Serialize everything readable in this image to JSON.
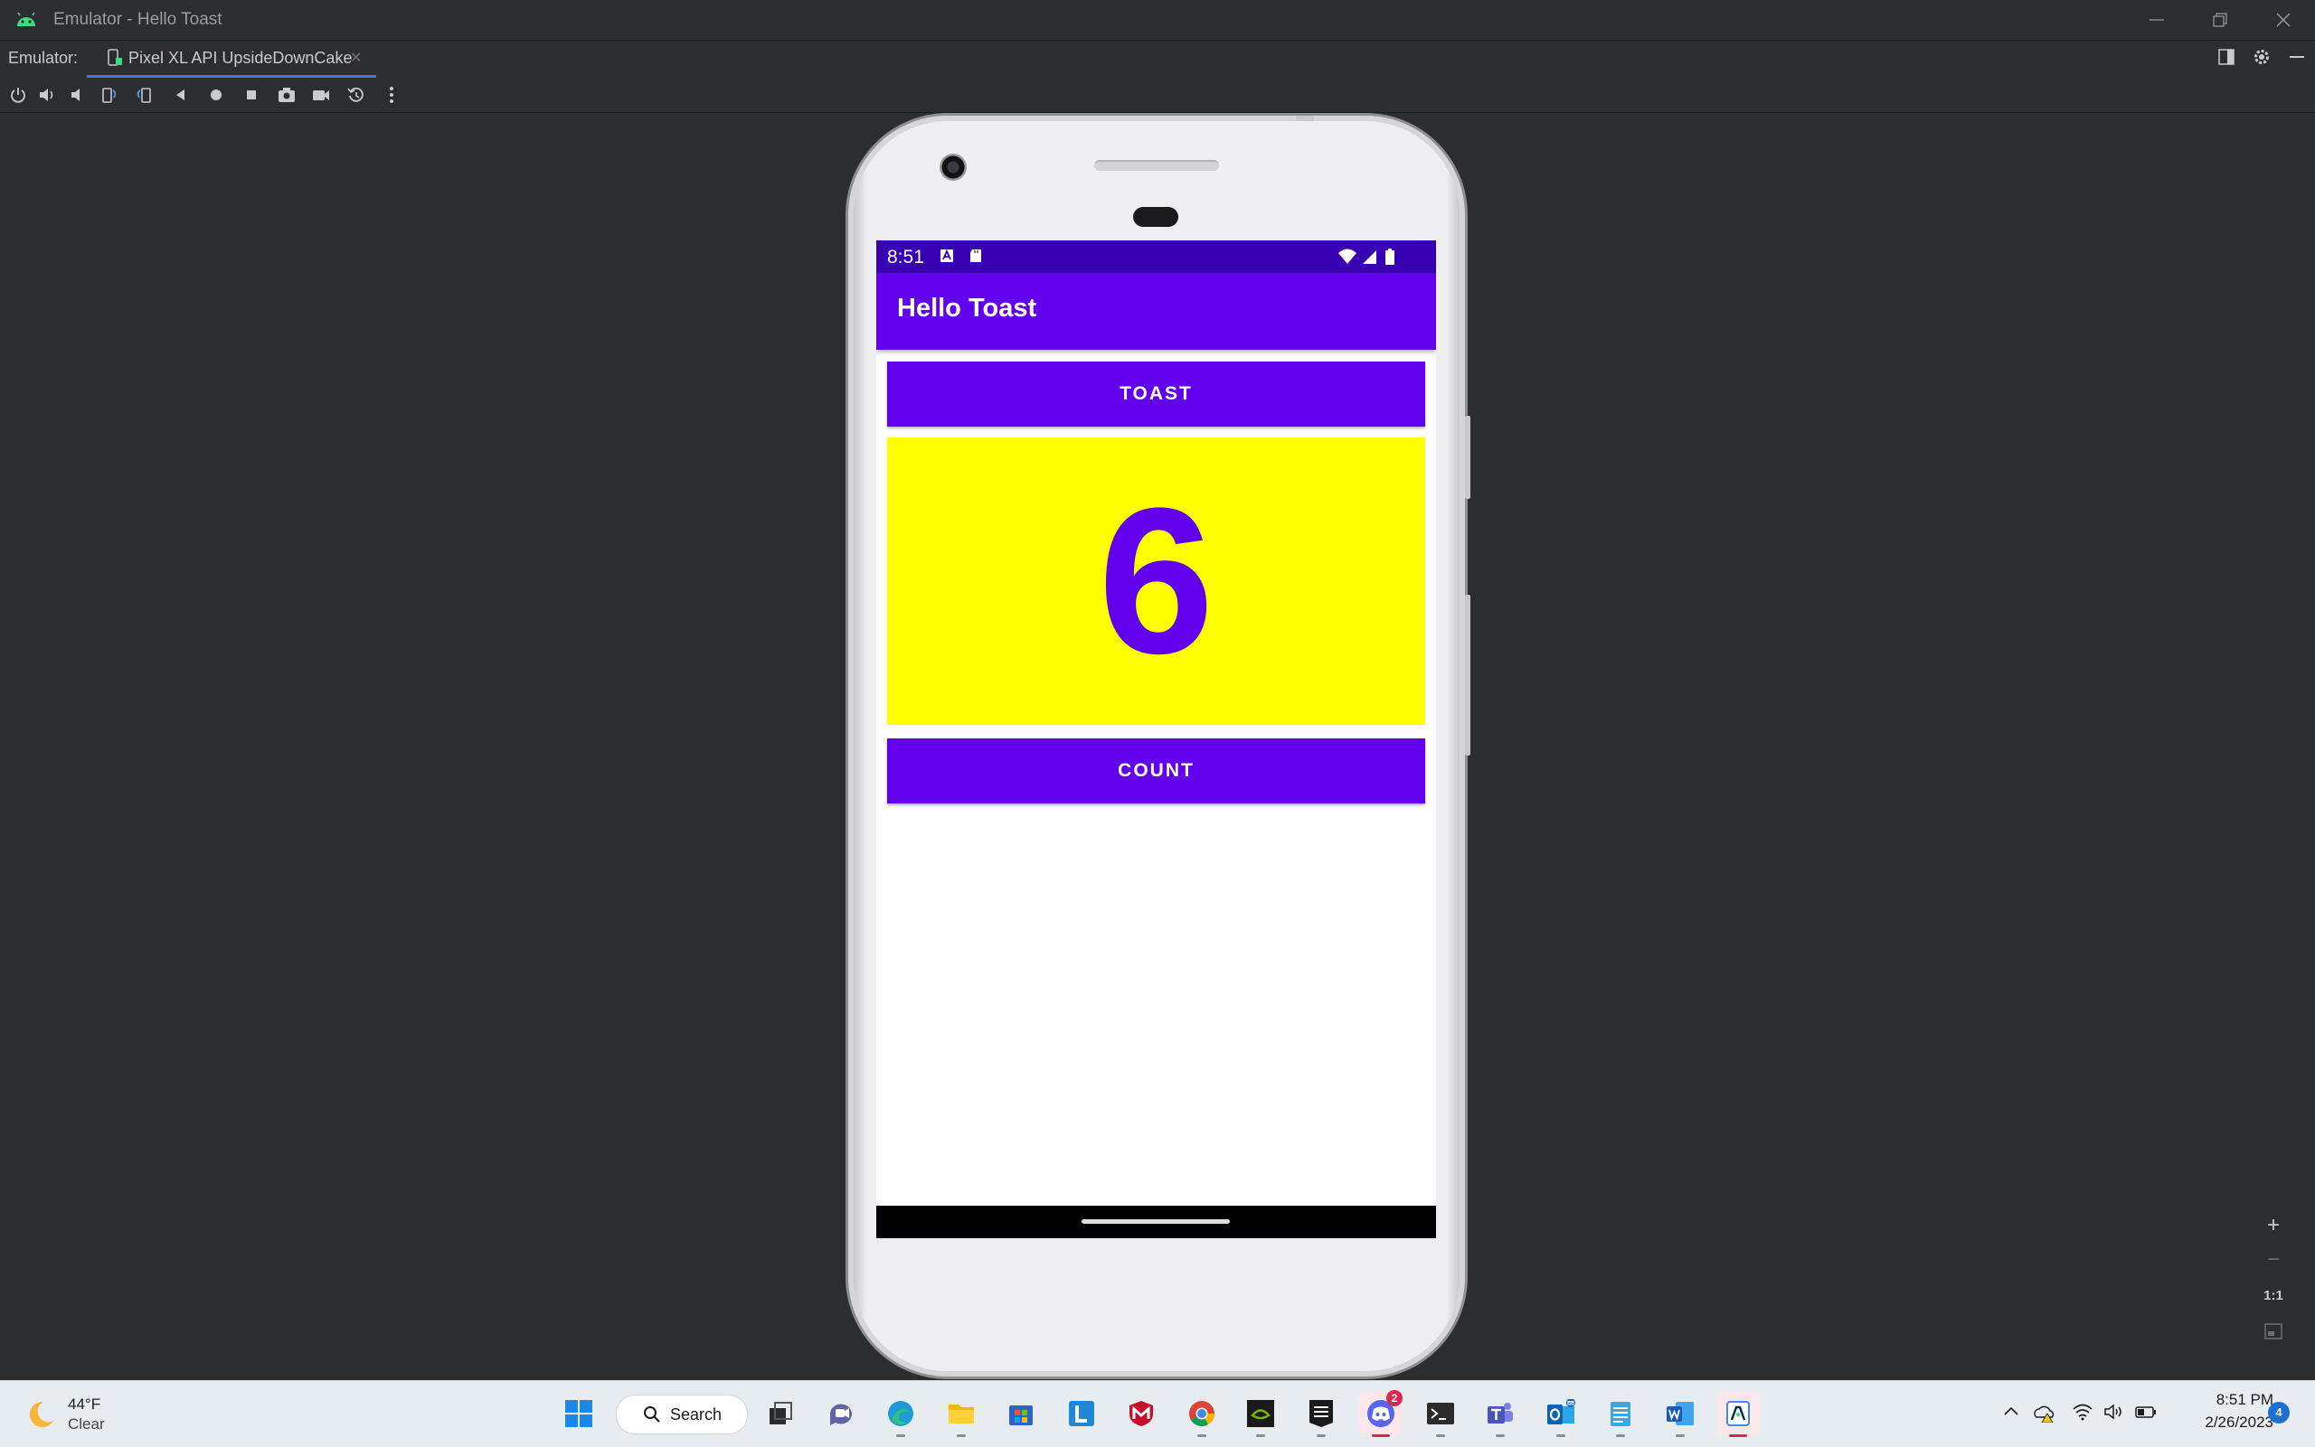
{
  "window": {
    "title": "Emulator - Hello Toast"
  },
  "tabs": {
    "label": "Emulator:",
    "device_tab": "Pixel XL API UpsideDownCake",
    "close_glyph": "✕"
  },
  "toolbar": {
    "icons": [
      "power-icon",
      "volume-up-icon",
      "volume-down-icon",
      "rotate-left-icon",
      "rotate-right-icon",
      "back-icon",
      "home-icon",
      "overview-icon",
      "screenshot-icon",
      "screen-record-icon",
      "snapshot-icon",
      "more-icon"
    ]
  },
  "device": {
    "status_time": "8:51",
    "status_icons": [
      "notification-a-icon",
      "sd-card-icon",
      "wifi-icon",
      "signal-icon",
      "battery-icon"
    ],
    "app_title": "Hello Toast",
    "toast_button": "TOAST",
    "count_value": "6",
    "count_button": "COUNT",
    "colors": {
      "status_bar": "#3700b3",
      "app_bar": "#6200ee",
      "count_background": "#ffff00",
      "count_text": "#6200ee"
    }
  },
  "zoom": {
    "zoom_in": "+",
    "zoom_out": "−",
    "actual_size": "1:1",
    "fit_icon": "fit-screen-icon"
  },
  "taskbar": {
    "weather_temp": "44°F",
    "weather_cond": "Clear",
    "search_label": "Search",
    "chat_badge": "2",
    "time": "8:51 PM",
    "date": "2/26/2023",
    "notification_count": "4",
    "apps": [
      "start-icon",
      "search",
      "task-view-icon",
      "chat-icon",
      "edge-icon",
      "file-explorer-icon",
      "store-icon",
      "l-app-icon",
      "mcafee-icon",
      "chrome-icon",
      "nvidia-icon",
      "epic-games-icon",
      "discord-icon",
      "terminal-icon",
      "teams-icon",
      "outlook-icon",
      "notepad-icon",
      "word-icon",
      "android-studio-icon"
    ]
  }
}
